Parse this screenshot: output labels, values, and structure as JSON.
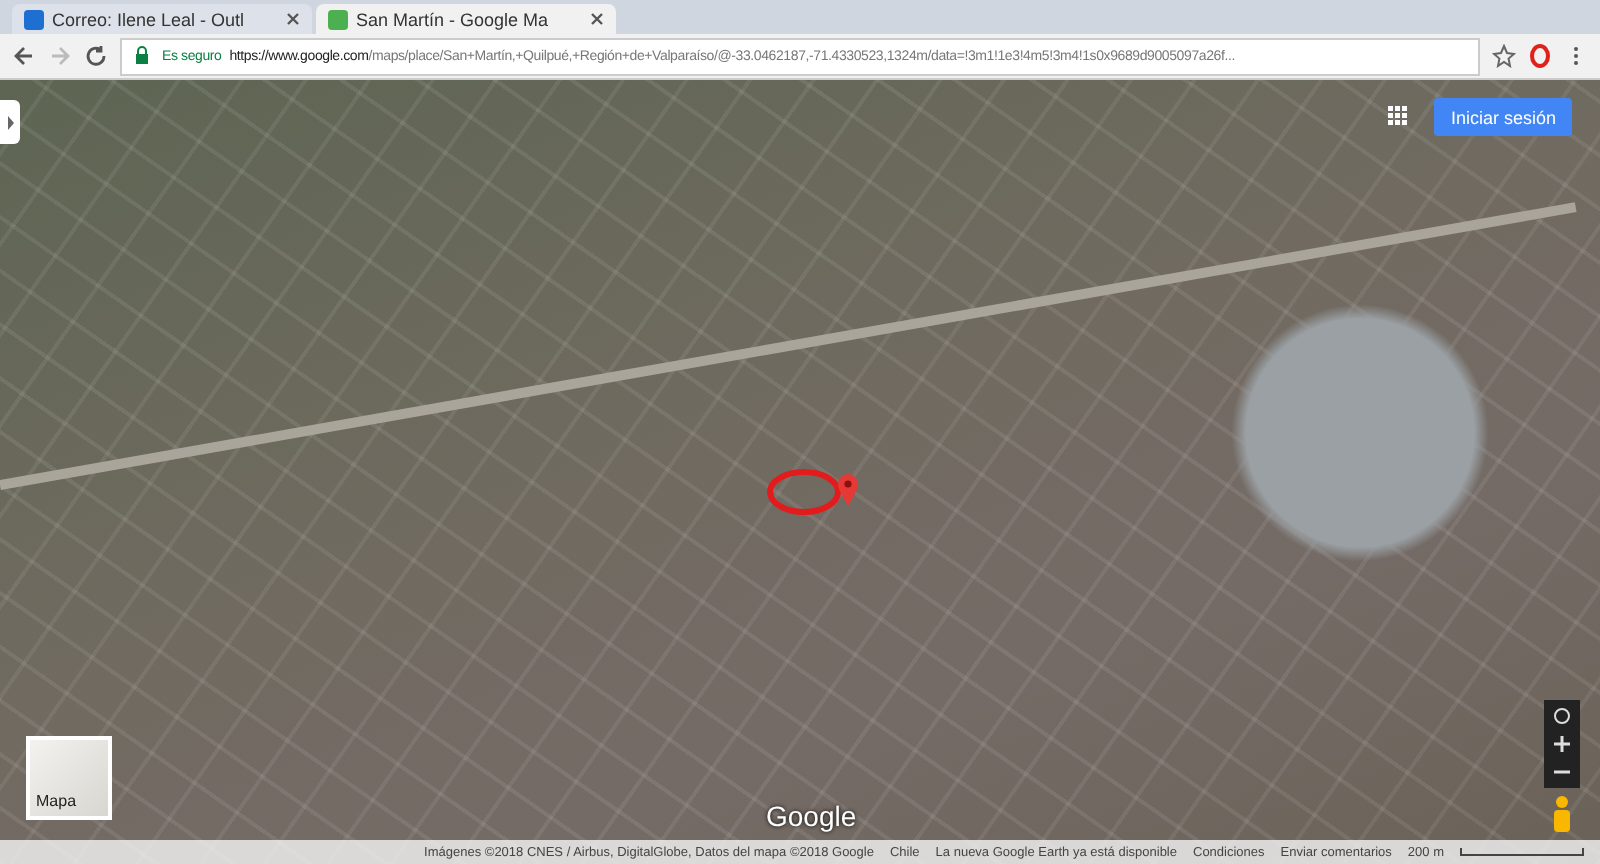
{
  "tabs": [
    {
      "title": "Correo: Ilene Leal - Outl",
      "selected": false
    },
    {
      "title": "San Martín - Google Ma",
      "selected": true
    }
  ],
  "address_bar": {
    "secure_label": "Es seguro",
    "url_host": "https://www.google.com",
    "url_path": "/maps/place/San+Martín,+Quilpué,+Región+de+Valparaíso/@-33.0462187,-71.4330523,1324m/data=!3m1!1e3!4m5!3m4!1s0x9689d9005097a26f..."
  },
  "map": {
    "sign_in": "Iniciar sesión",
    "layer_thumbnail": "Mapa",
    "logo": "Google"
  },
  "footer": {
    "attribution": "Imágenes ©2018 CNES / Airbus, DigitalGlobe, Datos del mapa ©2018 Google",
    "links": [
      "Chile",
      "La nueva Google Earth ya está disponible",
      "Condiciones",
      "Enviar comentarios"
    ],
    "scale": "200 m"
  }
}
